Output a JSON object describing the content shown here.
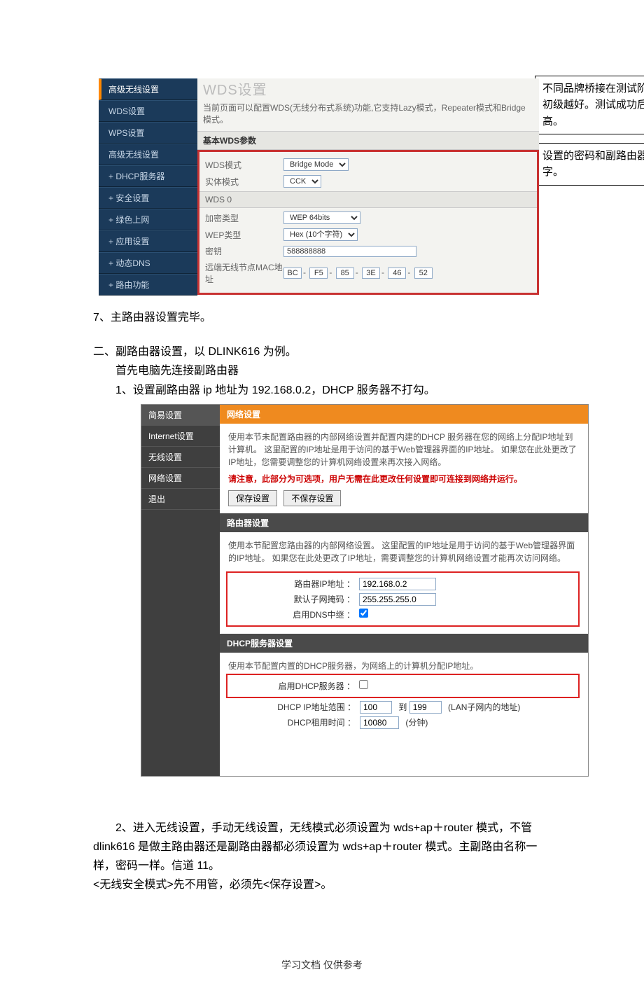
{
  "top_panel": {
    "title": "WDS设置",
    "desc": "当前页面可以配置WDS(无线分布式系统)功能,它支持Lazy模式，Repeater模式和Bridge模式。",
    "section": "基本WDS参数",
    "sidebar": [
      {
        "label": "高级无线设置",
        "active": true
      },
      {
        "label": "WDS设置"
      },
      {
        "label": "WPS设置"
      },
      {
        "label": "高级无线设置"
      },
      {
        "label": "+ DHCP服务器"
      },
      {
        "label": "+ 安全设置"
      },
      {
        "label": "+ 绿色上网"
      },
      {
        "label": "+ 应用设置"
      },
      {
        "label": "+ 动态DNS"
      },
      {
        "label": "+ 路由功能"
      }
    ],
    "rows": {
      "wds_mode_label": "WDS模式",
      "wds_mode_value": "Bridge Mode",
      "phy_mode_label": "实体模式",
      "phy_mode_value": "CCK",
      "wds0_label": "WDS 0",
      "enc_type_label": "加密类型",
      "enc_type_value": "WEP 64bits",
      "wep_type_label": "WEP类型",
      "wep_type_value": "Hex (10个字符)",
      "key_label": "密钥",
      "key_value": "588888888",
      "mac_label": "远端无线节点MAC地址",
      "mac": [
        "BC",
        "F5",
        "85",
        "3E",
        "46",
        "52"
      ]
    }
  },
  "callouts": {
    "c1": "不同品牌桥接在测试阶段，加密类型越初级越好。测试成功后可把加密等级提高。",
    "c2": "设置的密码和副路由器一样的数字。"
  },
  "mid_text": {
    "l1": "7、主路由器设置完毕。",
    "l2": "二、副路由器设置，以 DLINK616 为例。",
    "l3": "首先电脑先连接副路由器",
    "l4": "1、设置副路由器 ip 地址为 192.168.0.2，DHCP 服务器不打勾。"
  },
  "dlink": {
    "side": [
      {
        "label": "简易设置",
        "active": true
      },
      {
        "label": "Internet设置"
      },
      {
        "label": "无线设置"
      },
      {
        "label": "网络设置"
      },
      {
        "label": "退出"
      }
    ],
    "header1": "网络设置",
    "box1_note": "使用本节未配置路由器的内部网络设置并配置内建的DHCP 服务器在您的网络上分配IP地址到计算机。 这里配置的IP地址是用于访问的基于Web管理器界面的IP地址。 如果您在此处更改了IP地址，您需要调整您的计算机网络设置来再次接入网络。",
    "box1_warn": "请注意，此部分为可选项，用户无需在此更改任何设置即可连接到网络并运行。",
    "btn_save": "保存设置",
    "btn_nosave": "不保存设置",
    "sub1": "路由器设置",
    "sub1_note": "使用本节配置您路由器的内部网络设置。 这里配置的IP地址是用于访问的基于Web管理器界面的IP地址。 如果您在此处更改了IP地址，需要调整您的计算机网络设置才能再次访问网络。",
    "router_ip_label": "路由器IP地址 ：",
    "router_ip_value": "192.168.0.2",
    "subnet_label": "默认子网掩码 ：",
    "subnet_value": "255.255.255.0",
    "dns_relay_label": "启用DNS中继 ：",
    "sub2": "DHCP服务器设置",
    "sub2_note": "使用本节配置内置的DHCP服务器，为网络上的计算机分配IP地址。",
    "enable_dhcp_label": "启用DHCP服务器 ：",
    "range_label": "DHCP IP地址范围 ：",
    "range_from": "100",
    "range_mid": "到",
    "range_to": "199",
    "range_note": "(LAN子网内的地址)",
    "lease_label": "DHCP租用时间 ：",
    "lease_value": "10080",
    "lease_unit": "(分钟)"
  },
  "para2": {
    "p1": "2、进入无线设置，手动无线设置，无线模式必须设置为 wds+ap＋router 模式，不管 dlink616 是做主路由器还是副路由器都必须设置为 wds+ap＋router 模式。主副路由名称一样，密码一样。信道 11。",
    "p2": "<无线安全模式>先不用管，必须先<保存设置>。"
  },
  "footer": "学习文档 仅供参考"
}
